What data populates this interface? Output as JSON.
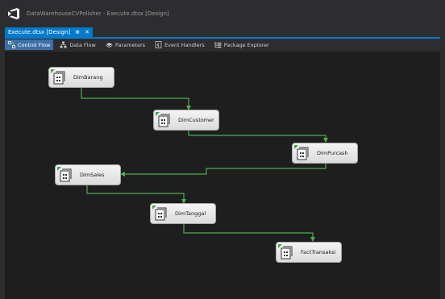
{
  "window": {
    "title": "DataWarehouseCVPolisher - Execute.dtsx [Design]"
  },
  "document_tab": {
    "label": "Execute.dtsx [Design]",
    "pin_glyph": "⊕",
    "close_glyph": "✕"
  },
  "designer_tabs": [
    {
      "label": "Control Flow",
      "active": true,
      "icon": "control-flow-icon"
    },
    {
      "label": "Data Flow",
      "active": false,
      "icon": "data-flow-icon"
    },
    {
      "label": "Parameters",
      "active": false,
      "icon": "parameters-icon"
    },
    {
      "label": "Event Handlers",
      "active": false,
      "icon": "event-handlers-icon"
    },
    {
      "label": "Package Explorer",
      "active": false,
      "icon": "package-explorer-icon"
    }
  ],
  "tasks": [
    {
      "id": "dim-barang",
      "label": "DimBarang"
    },
    {
      "id": "dim-customer",
      "label": "DimCustomer"
    },
    {
      "id": "dim-purcash",
      "label": "DimPurcash"
    },
    {
      "id": "dim-sales",
      "label": "DimSales"
    },
    {
      "id": "dim-tanggal",
      "label": "DimTanggal"
    },
    {
      "id": "fact-transaksi",
      "label": "FactTransaksi"
    }
  ],
  "colors": {
    "accent": "#007acc",
    "connector": "#4caf50",
    "canvas": "#1e1e1e",
    "chrome": "#2d2d30"
  }
}
